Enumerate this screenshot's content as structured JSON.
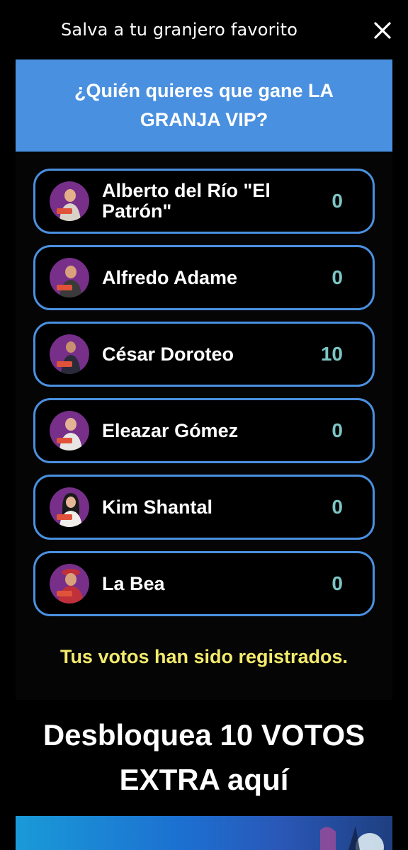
{
  "header": {
    "title": "Salva a tu granjero favorito",
    "close_icon": "close-icon"
  },
  "poll": {
    "question": "¿Quién quieres que gane LA GRANJA VIP?",
    "options": [
      {
        "name": "Alberto del Río \"El Patrón\"",
        "votes": "0"
      },
      {
        "name": "Alfredo Adame",
        "votes": "0"
      },
      {
        "name": "César Doroteo",
        "votes": "10"
      },
      {
        "name": "Eleazar Gómez",
        "votes": "0"
      },
      {
        "name": "Kim Shantal",
        "votes": "0"
      },
      {
        "name": "La Bea",
        "votes": "0"
      }
    ],
    "status_message": "Tus votos han sido registrados."
  },
  "cta": {
    "label": "Desbloquea 10 VOTOS EXTRA aquí"
  },
  "colors": {
    "accent": "#4a90e0",
    "vote_count": "#7cc5c5",
    "status": "#f3ea6c",
    "background": "#000000"
  }
}
